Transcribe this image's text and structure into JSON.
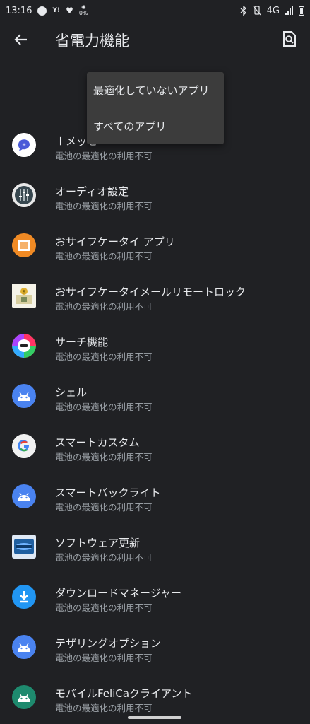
{
  "status_bar": {
    "time": "13:16",
    "yahoo_label": "Y!",
    "pct_label": "0%",
    "network": "4G"
  },
  "toolbar": {
    "title": "省電力機能"
  },
  "dropdown": {
    "items": [
      "最適化していないアプリ",
      "すべてのアプリ"
    ]
  },
  "apps": [
    {
      "name": "＋メッセ",
      "sub": "電池の最適化の利用不可",
      "icon": "plus-message-icon"
    },
    {
      "name": "オーディオ設定",
      "sub": "電池の最適化の利用不可",
      "icon": "audio-settings-icon"
    },
    {
      "name": "おサイフケータイ アプリ",
      "sub": "電池の最適化の利用不可",
      "icon": "osaifu-keitai-icon"
    },
    {
      "name": "おサイフケータイメールリモートロック",
      "sub": "電池の最適化の利用不可",
      "icon": "remote-lock-icon"
    },
    {
      "name": "サーチ機能",
      "sub": "電池の最適化の利用不可",
      "icon": "search-function-icon"
    },
    {
      "name": "シェル",
      "sub": "電池の最適化の利用不可",
      "icon": "android-icon"
    },
    {
      "name": "スマートカスタム",
      "sub": "電池の最適化の利用不可",
      "icon": "google-icon"
    },
    {
      "name": "スマートバックライト",
      "sub": "電池の最適化の利用不可",
      "icon": "android-icon"
    },
    {
      "name": "ソフトウェア更新",
      "sub": "電池の最適化の利用不可",
      "icon": "xperia-icon"
    },
    {
      "name": "ダウンロードマネージャー",
      "sub": "電池の最適化の利用不可",
      "icon": "download-icon"
    },
    {
      "name": "テザリングオプション",
      "sub": "電池の最適化の利用不可",
      "icon": "android-icon"
    },
    {
      "name": "モバイルFeliCaクライアント",
      "sub": "電池の最適化の利用不可",
      "icon": "android-icon"
    }
  ],
  "colors": {
    "background": "#202124",
    "menu_background": "#3c3c3c",
    "android_blue": "#4a83f0",
    "download_blue": "#2196f3",
    "felica_green": "#1e8a6e"
  }
}
